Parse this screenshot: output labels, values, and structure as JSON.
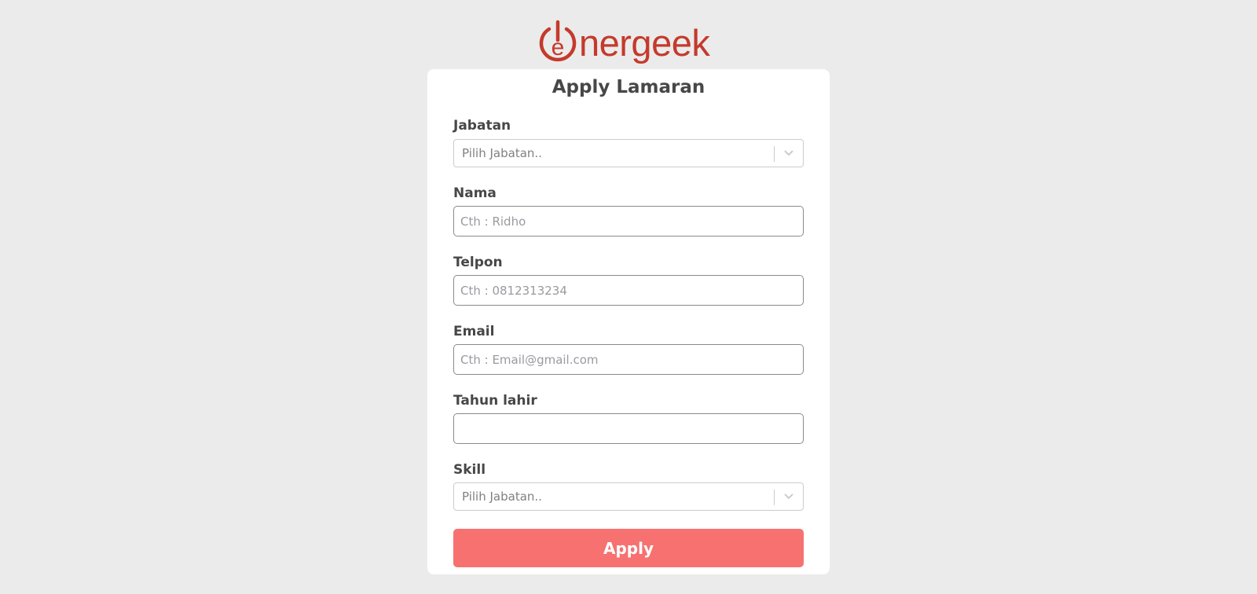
{
  "brand": {
    "logo_text": "nergeek",
    "logo_color": "#c43a2c"
  },
  "form": {
    "title": "Apply Lamaran",
    "fields": {
      "jabatan": {
        "label": "Jabatan",
        "placeholder": "Pilih Jabatan.."
      },
      "nama": {
        "label": "Nama",
        "placeholder": "Cth : Ridho",
        "value": ""
      },
      "telpon": {
        "label": "Telpon",
        "placeholder": "Cth : 0812313234",
        "value": ""
      },
      "email": {
        "label": "Email",
        "placeholder": "Cth : Email@gmail.com",
        "value": ""
      },
      "tahun_lahir": {
        "label": "Tahun lahir",
        "placeholder": "",
        "value": ""
      },
      "skill": {
        "label": "Skill",
        "placeholder": "Pilih Jabatan.."
      }
    },
    "submit_label": "Apply",
    "submit_color": "#f77171"
  },
  "icons": {
    "logo": "power-e-icon",
    "dropdown": "chevron-down-icon"
  }
}
